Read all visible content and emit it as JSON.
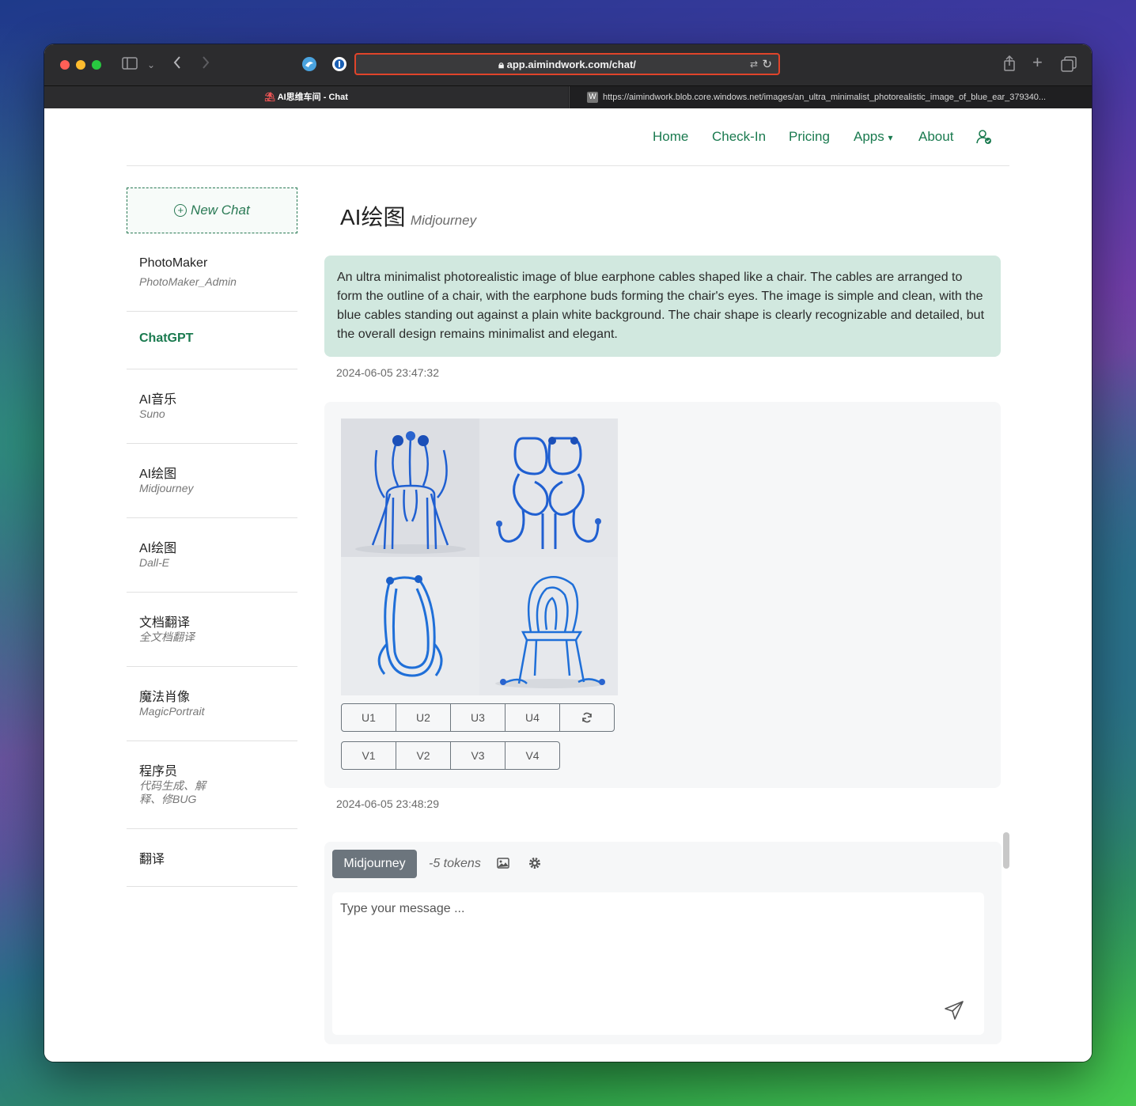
{
  "browser": {
    "url": "app.aimindwork.com/chat/",
    "tabs": [
      {
        "label": "AI思维车间 - Chat"
      },
      {
        "label": "https://aimindwork.blob.core.windows.net/images/an_ultra_minimalist_photorealistic_image_of_blue_ear_379340..."
      }
    ],
    "tab_favicon_letter": "W"
  },
  "nav": {
    "links": [
      "Home",
      "Check-In",
      "Pricing",
      "Apps",
      "About"
    ],
    "apps_caret": "▾",
    "account_icon": "user-check-icon"
  },
  "sidebar": {
    "new_chat": "New Chat",
    "items": [
      {
        "title": "PhotoMaker",
        "subtitle": "PhotoMaker_Admin"
      },
      {
        "title": "ChatGPT",
        "subtitle": ""
      },
      {
        "title": "AI音乐",
        "subtitle": "Suno"
      },
      {
        "title": "AI绘图",
        "subtitle": "Midjourney"
      },
      {
        "title": "AI绘图",
        "subtitle": "Dall-E"
      },
      {
        "title": "文档翻译",
        "subtitle": "全文档翻译"
      },
      {
        "title": "魔法肖像",
        "subtitle": "MagicPortrait"
      },
      {
        "title": "程序员",
        "subtitle": "代码生成、解释、修BUG"
      },
      {
        "title": "翻译",
        "subtitle": ""
      }
    ],
    "active_color": "#1a7a4f"
  },
  "header": {
    "title": "AI绘图",
    "subtitle": "Midjourney"
  },
  "messages": {
    "user_text": "An ultra minimalist photorealistic image of blue earphone cables shaped like a chair. The cables are arranged to form the outline of a chair, with the earphone buds forming the chair's eyes. The image is simple and clean, with the blue cables standing out against a plain white background. The chair shape is clearly recognizable and detailed, but the overall design remains minimalist and elegant.",
    "user_time": "2024-06-05 23:47:32",
    "bot_time": "2024-06-05 23:48:29",
    "upscale_buttons": [
      "U1",
      "U2",
      "U3",
      "U4"
    ],
    "variation_buttons": [
      "V1",
      "V2",
      "V3",
      "V4"
    ],
    "reroll_icon": "refresh-icon"
  },
  "composer": {
    "model": "Midjourney",
    "cost": "-5 tokens",
    "placeholder": "Type your message ...",
    "image_icon": "image-icon",
    "settings_icon": "gear-icon",
    "send_icon": "send-icon"
  },
  "colors": {
    "brand_green": "#1a7a4f",
    "user_bubble": "#d1e8df",
    "url_highlight": "#e0442a",
    "cable_blue": "#1f5fd1"
  }
}
